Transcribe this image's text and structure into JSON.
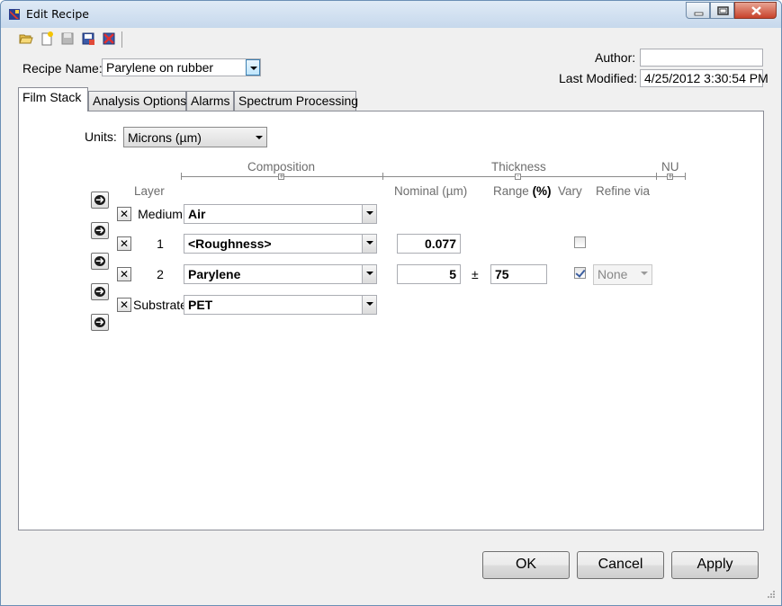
{
  "window": {
    "title": "Edit Recipe"
  },
  "toolbar": {
    "icons": [
      "open-folder-icon",
      "new-file-icon",
      "save-icon",
      "save-as-icon",
      "delete-recipe-icon"
    ]
  },
  "recipe": {
    "label": "Recipe Name:",
    "value": "Parylene on rubber"
  },
  "author": {
    "label": "Author:",
    "value": ""
  },
  "last_modified": {
    "label": "Last Modified:",
    "value": "4/25/2012 3:30:54 PM"
  },
  "tabs": [
    {
      "label": "Film Stack",
      "active": true
    },
    {
      "label": "Analysis Options"
    },
    {
      "label": "Alarms"
    },
    {
      "label": "Spectrum Processing"
    }
  ],
  "units": {
    "label": "Units:",
    "value": "Microns (µm)"
  },
  "headers": {
    "composition": "Composition",
    "thickness": "Thickness",
    "nu": "NU",
    "layer": "Layer",
    "nominal": "Nominal (µm)",
    "range": "Range",
    "range_unit": "(%)",
    "vary": "Vary",
    "refine_via": "Refine via"
  },
  "layers": [
    {
      "label": "Medium",
      "material": "Air"
    },
    {
      "label": "1",
      "material": "<Roughness>",
      "nominal": "0.077",
      "vary": false
    },
    {
      "label": "2",
      "material": "Parylene",
      "nominal": "5",
      "plusminus": "±",
      "range": "75",
      "vary": true,
      "refine_via": "None"
    },
    {
      "label": "Substrate",
      "material": "PET"
    }
  ],
  "buttons": {
    "ok": "OK",
    "cancel": "Cancel",
    "apply": "Apply"
  },
  "colors": {
    "titlebar": "#c6d8ec",
    "dialog_bg": "#f0f0f0",
    "close_button": "#c7412a",
    "checkbox_mark": "#3c5ea0"
  }
}
